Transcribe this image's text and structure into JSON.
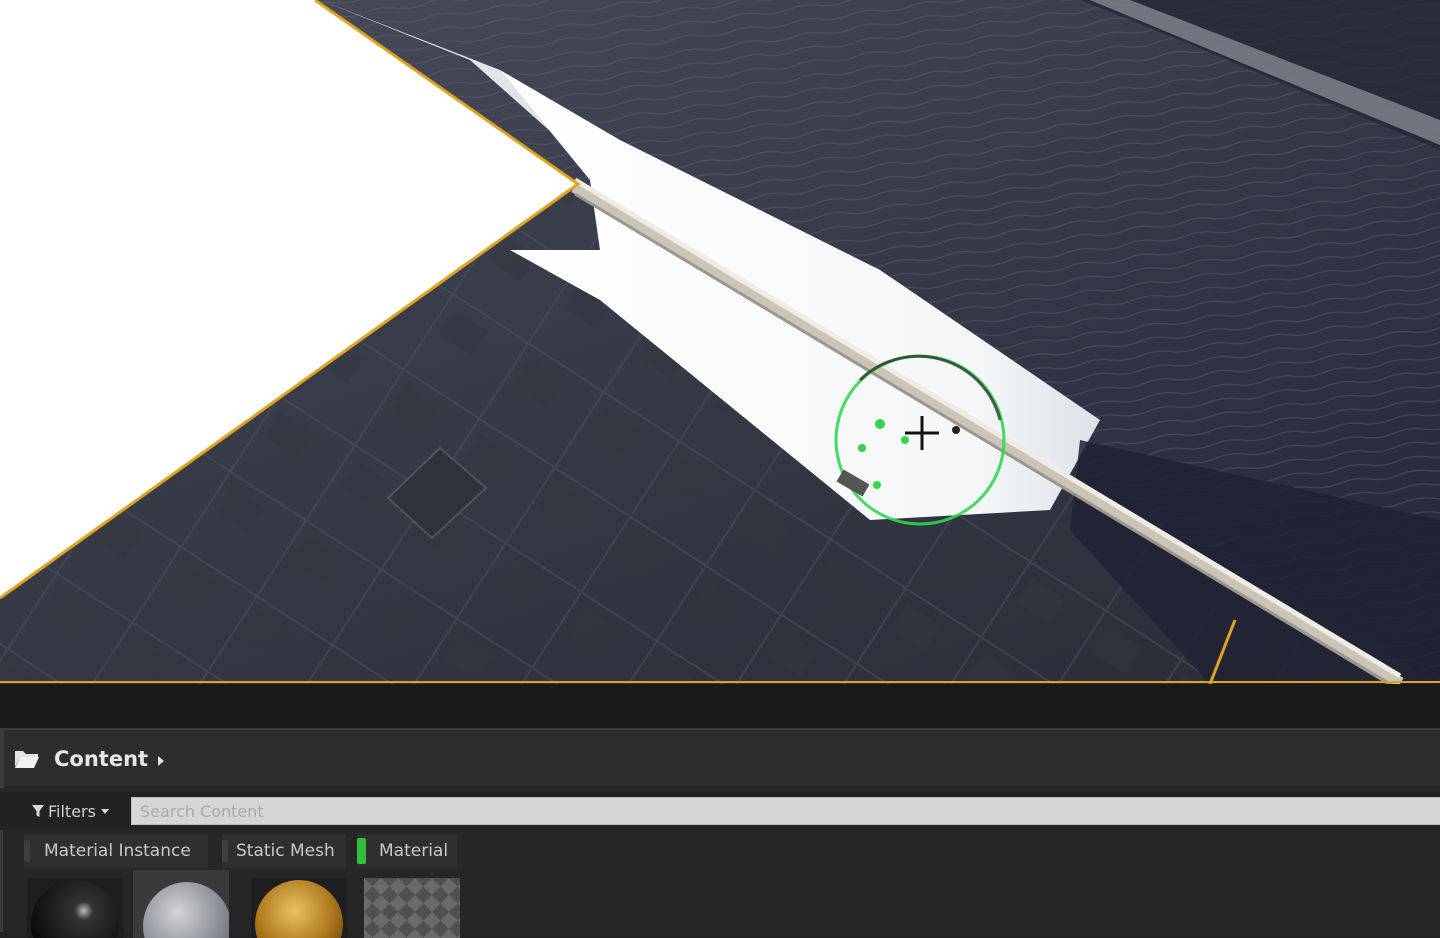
{
  "content_browser": {
    "title": "Content",
    "folder_icon": "folder-open-icon",
    "path_arrow_icon": "caret-right-icon",
    "filters_label": "Filters",
    "filters_icon": "funnel-icon",
    "filters_dropdown_icon": "caret-down-icon",
    "search_placeholder": "Search Content",
    "filter_chips": [
      {
        "label": "Material Instance",
        "color": "#3f3f3f",
        "active": false
      },
      {
        "label": "Static Mesh",
        "color": "#3f3f3f",
        "active": false
      },
      {
        "label": "Material",
        "color": "#2fbf3b",
        "active": true
      }
    ],
    "assets": [
      {
        "icon": "black-sphere-thumbnail-icon"
      },
      {
        "icon": "grey-sphere-thumbnail-icon",
        "selected": true
      },
      {
        "icon": "gold-sphere-thumbnail-icon"
      },
      {
        "icon": "checker-thumbnail-icon"
      }
    ]
  },
  "viewport": {
    "brush_icon": "sculpt-brush-circle-icon",
    "cursor_icon": "crosshair-cursor-icon",
    "selection_color": "#e0a21f",
    "brush_color": "#2dd94a"
  }
}
